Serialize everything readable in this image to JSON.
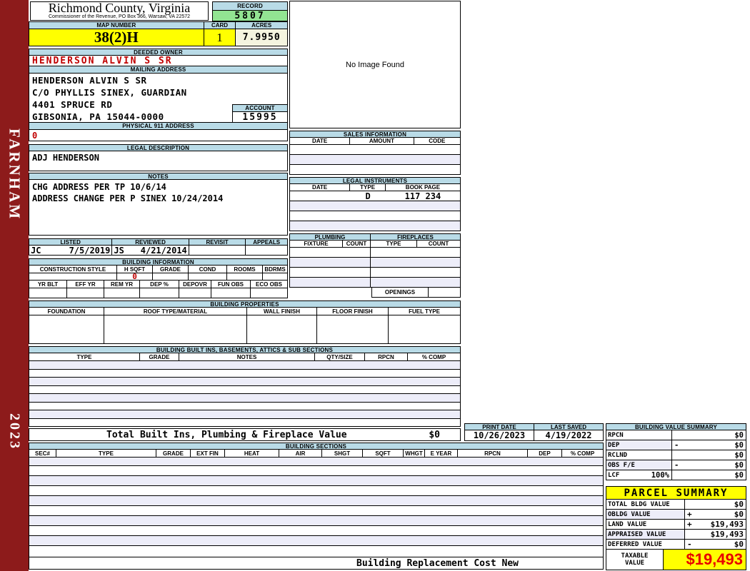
{
  "sidebar": {
    "district": "FARNHAM",
    "year": "2023"
  },
  "header": {
    "county": "Richmond County, Virginia",
    "commissioner": "Commissioner of the Revenue, PO Box 366, Warsaw, VA 22572",
    "record_label": "RECORD",
    "record": "5807",
    "map_number_label": "MAP NUMBER",
    "map_number": "38(2)H",
    "card_label": "CARD",
    "card": "1",
    "acres_label": "ACRES",
    "acres": "7.9950"
  },
  "owner": {
    "deeded_owner_label": "DEEDED OWNER",
    "deeded_owner": "HENDERSON ALVIN S SR",
    "mailing_address_label": "MAILING ADDRESS",
    "mailing_address": [
      "HENDERSON ALVIN S SR",
      "C/O PHYLLIS SINEX, GUARDIAN",
      "4401 SPRUCE RD",
      "GIBSONIA, PA 15044-0000"
    ],
    "account_label": "ACCOUNT",
    "account": "15995",
    "physical_911_label": "PHYSICAL 911 ADDRESS",
    "physical_911": "0",
    "legal_description_label": "LEGAL DESCRIPTION",
    "legal_description": "ADJ HENDERSON",
    "notes_label": "NOTES",
    "notes": [
      "CHG ADDRESS PER TP 10/6/14",
      "ADDRESS CHANGE PER P SINEX 10/24/2014"
    ]
  },
  "review": {
    "listed_label": "LISTED",
    "listed_by": "JC",
    "listed_date": "7/5/2019",
    "reviewed_label": "REVIEWED",
    "reviewed_by": "JS",
    "reviewed_date": "4/21/2014",
    "revisit_label": "REVISIT",
    "appeals_label": "APPEALS"
  },
  "no_image": "No Image Found",
  "sales": {
    "title": "SALES INFORMATION",
    "columns": [
      "DATE",
      "AMOUNT",
      "CODE"
    ]
  },
  "legal_instruments": {
    "title": "LEGAL INSTRUMENTS",
    "columns": [
      "DATE",
      "TYPE",
      "BOOK PAGE"
    ],
    "row1": {
      "date": "",
      "type": "D",
      "book_page": "117 234"
    }
  },
  "plumbing": {
    "title": "PLUMBING",
    "columns": [
      "FIXTURE",
      "COUNT"
    ]
  },
  "fireplaces": {
    "title": "FIREPLACES",
    "columns": [
      "TYPE",
      "COUNT"
    ],
    "openings_label": "OPENINGS"
  },
  "building_information": {
    "title": "BUILDING INFORMATION",
    "row1_columns": [
      "CONSTRUCTION STYLE",
      "H SQFT",
      "GRADE",
      "COND",
      "ROOMS",
      "BDRMS"
    ],
    "h_sqft": "0",
    "row2_columns": [
      "YR BLT",
      "EFF YR",
      "REM YR",
      "DEP %",
      "DEPOVR",
      "FUN OBS",
      "ECO OBS"
    ]
  },
  "building_properties": {
    "title": "BUILDING PROPERTIES",
    "columns": [
      "FOUNDATION",
      "ROOF TYPE/MATERIAL",
      "WALL FINISH",
      "FLOOR FINISH",
      "FUEL TYPE"
    ]
  },
  "built_ins": {
    "title": "BUILDING BUILT INS, BASEMENTS, ATTICS & SUB SECTIONS",
    "columns": [
      "TYPE",
      "GRADE",
      "NOTES",
      "QTY/SIZE",
      "RPCN",
      "% COMP"
    ],
    "total_label": "Total Built Ins, Plumbing & Fireplace Value",
    "total_value": "$0"
  },
  "building_sections": {
    "title": "BUILDING SECTIONS",
    "columns": [
      "SEC#",
      "TYPE",
      "GRADE",
      "EXT FIN",
      "HEAT",
      "AIR",
      "SHGT",
      "SQFT",
      "WHGT",
      "E YEAR",
      "RPCN",
      "DEP",
      "% COMP"
    ],
    "footer": "Building Replacement Cost New"
  },
  "print_info": {
    "print_date_label": "PRINT DATE",
    "print_date": "10/26/2023",
    "last_saved_label": "LAST SAVED",
    "last_saved": "4/19/2022"
  },
  "building_value_summary": {
    "title": "BUILDING VALUE SUMMARY",
    "rows": [
      {
        "label": "RPCN",
        "pct": "",
        "sign": "",
        "value": "$0"
      },
      {
        "label": "DEP",
        "pct": "",
        "sign": "-",
        "value": "$0"
      },
      {
        "label": "RCLND",
        "pct": "",
        "sign": "",
        "value": "$0"
      },
      {
        "label": "OBS F/E",
        "pct": "",
        "sign": "-",
        "value": "$0"
      },
      {
        "label": "LCF",
        "pct": "100%",
        "sign": "",
        "value": "$0"
      }
    ]
  },
  "parcel_summary": {
    "title": "PARCEL SUMMARY",
    "rows": [
      {
        "label": "TOTAL BLDG VALUE",
        "sign": "",
        "value": "$0"
      },
      {
        "label": "OBLDG VALUE",
        "sign": "+",
        "value": "$0"
      },
      {
        "label": "LAND VALUE",
        "sign": "+",
        "value": "$19,493"
      },
      {
        "label": "APPRAISED VALUE",
        "sign": "",
        "value": "$19,493"
      },
      {
        "label": "DEFERRED VALUE",
        "sign": "-",
        "value": "$0"
      }
    ],
    "taxable_label": "TAXABLE VALUE",
    "taxable_value": "$19,493"
  },
  "colors": {
    "maroon": "#8d1b1b",
    "header_blue": "#b9dbe7",
    "highlight_yellow": "#ffff00",
    "record_green": "#92e492",
    "acres_cream": "#f4f4df",
    "accent_red": "#c00000",
    "taxable_red": "#e80000"
  }
}
